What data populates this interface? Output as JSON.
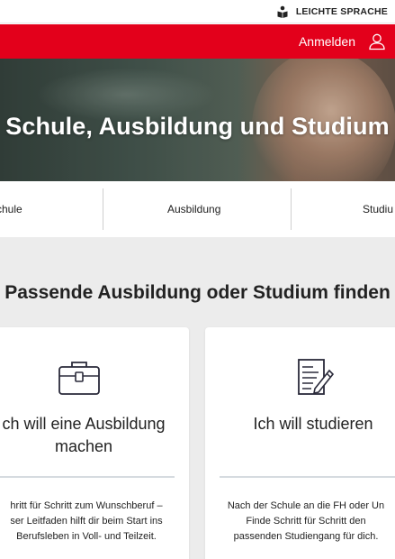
{
  "topbar": {
    "easy_language_label": "LEICHTE SPRACHE",
    "easy_language_icon": "book-reader-icon"
  },
  "header": {
    "login_label": "Anmelden",
    "login_icon": "user-icon",
    "brand_color": "#e3001b"
  },
  "hero": {
    "title": "Schule, Ausbildung und Studium"
  },
  "tabs": [
    {
      "label": "chule"
    },
    {
      "label": "Ausbildung"
    },
    {
      "label": "Studiu"
    }
  ],
  "section": {
    "title": "Passende Ausbildung oder Studium finden",
    "background": "#ececec"
  },
  "cards": [
    {
      "icon": "briefcase-icon",
      "title_lines": [
        "ch will eine Ausbildung",
        "machen"
      ],
      "text_lines": [
        "hritt für Schritt zum Wunschberuf –",
        "ser Leitfaden hilft dir beim Start ins",
        "Berufsleben in Voll- und Teilzeit."
      ]
    },
    {
      "icon": "document-pen-icon",
      "title_lines": [
        "Ich will studieren"
      ],
      "text_lines": [
        "Nach der Schule an die FH oder Un",
        "Finde Schritt für Schritt den",
        "passenden Studiengang für dich."
      ]
    }
  ]
}
